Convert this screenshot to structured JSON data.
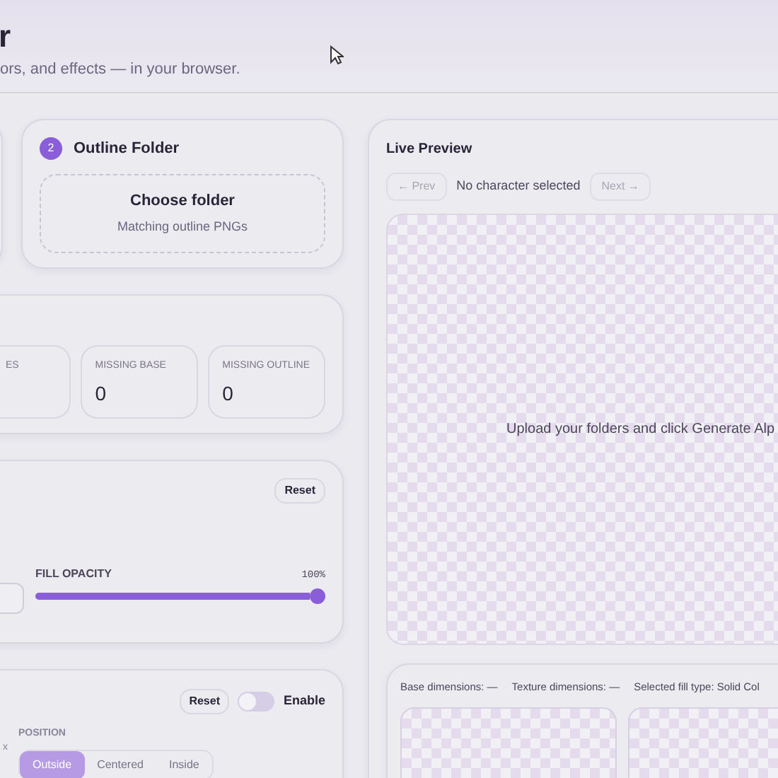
{
  "header": {
    "title": "r",
    "subtitle": "ors, and effects — in your browser."
  },
  "folders": [
    {
      "step": "2",
      "title": "Outline Folder",
      "action": "Choose folder",
      "hint": "Matching outline PNGs"
    }
  ],
  "stats": [
    {
      "label": "ES"
    },
    {
      "label": "MISSING BASE",
      "value": "0"
    },
    {
      "label": "MISSING OUTLINE",
      "value": "0"
    }
  ],
  "fill": {
    "reset": "Reset",
    "opacity_label": "FILL OPACITY",
    "opacity_reading": "100%",
    "level": 1
  },
  "outline": {
    "reset": "Reset",
    "enabled": false,
    "enable_label": "Enable",
    "cut_label": "x",
    "position_label": "POSITION",
    "positions": [
      {
        "label": "Outside",
        "selected": true
      },
      {
        "label": "Centered",
        "selected": false
      },
      {
        "label": "Inside",
        "selected": false
      }
    ]
  },
  "preview": {
    "title": "Live Preview",
    "prev": "← Prev",
    "next": "Next →",
    "nav_disabled": true,
    "status": "No character selected",
    "empty": "Upload your folders and click Generate Alp"
  },
  "info": [
    "Base dimensions: —",
    "Texture dimensions: —",
    "Selected fill type: Solid Col"
  ]
}
